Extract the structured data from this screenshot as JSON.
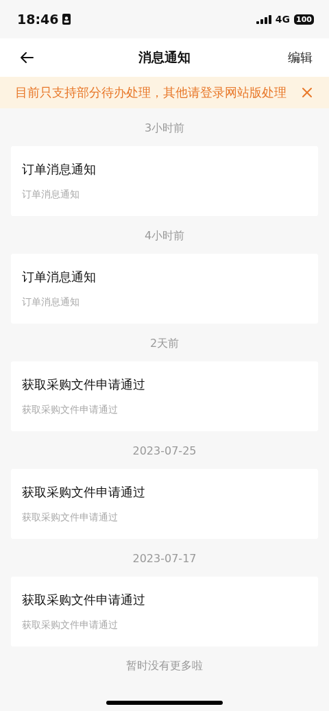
{
  "status_bar": {
    "time": "18:46",
    "network": "4G",
    "battery": "100"
  },
  "nav": {
    "title": "消息通知",
    "action": "编辑"
  },
  "notice": {
    "text": "目前只支持部分待办处理，其他请登录网站版处理"
  },
  "groups": [
    {
      "time": "3小时前",
      "title": "订单消息通知",
      "body": "订单消息通知"
    },
    {
      "time": "4小时前",
      "title": "订单消息通知",
      "body": "订单消息通知"
    },
    {
      "time": "2天前",
      "title": "获取采购文件申请通过",
      "body": "获取采购文件申请通过"
    },
    {
      "time": "2023-07-25",
      "title": "获取采购文件申请通过",
      "body": "获取采购文件申请通过"
    },
    {
      "time": "2023-07-17",
      "title": "获取采购文件申请通过",
      "body": "获取采购文件申请通过"
    }
  ],
  "footer": "暂时没有更多啦"
}
